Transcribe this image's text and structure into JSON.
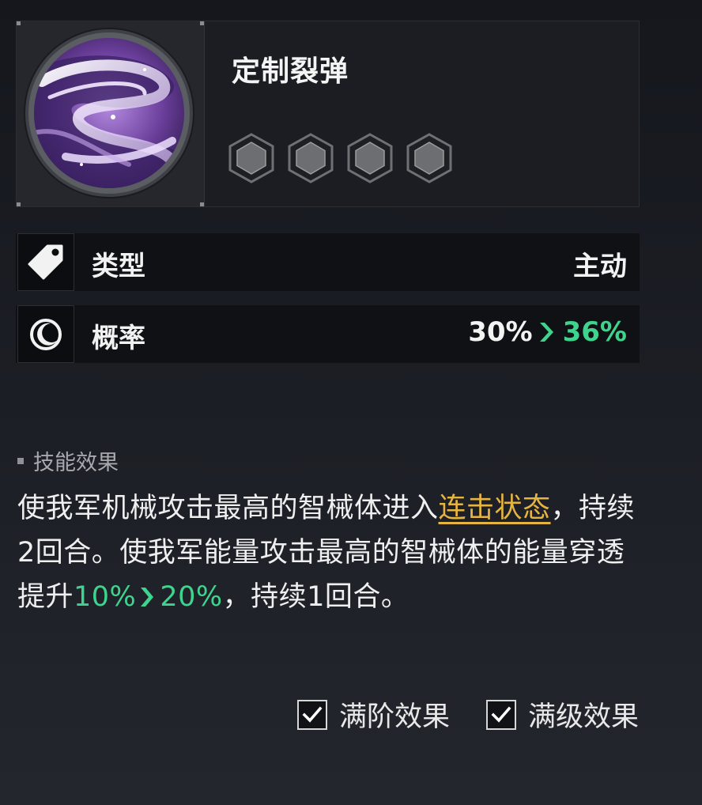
{
  "skill": {
    "name": "定制裂弹",
    "icon": "purple-swirl-icon",
    "star_slots": 4,
    "stars_filled": 0
  },
  "stats": [
    {
      "label": "类型",
      "icon": "tag-icon",
      "value": "主动"
    },
    {
      "label": "概率",
      "icon": "moon-icon",
      "value_from": "30%",
      "value_to": "36%"
    }
  ],
  "effect": {
    "title": "技能效果",
    "text_1": "使我军机械攻击最高的智械体进入",
    "keyword": "连击状态",
    "text_2": "，持续2回合。使我军能量攻击最高的智械体的能量穿透提升",
    "from": "10%",
    "to": "20%",
    "text_3": "，持续1回合。"
  },
  "toggles": [
    {
      "label": "满阶效果",
      "checked": true
    },
    {
      "label": "满级效果",
      "checked": true
    }
  ],
  "colors": {
    "upgrade_green": "#3fd48e",
    "keyword_gold": "#e6b440"
  }
}
